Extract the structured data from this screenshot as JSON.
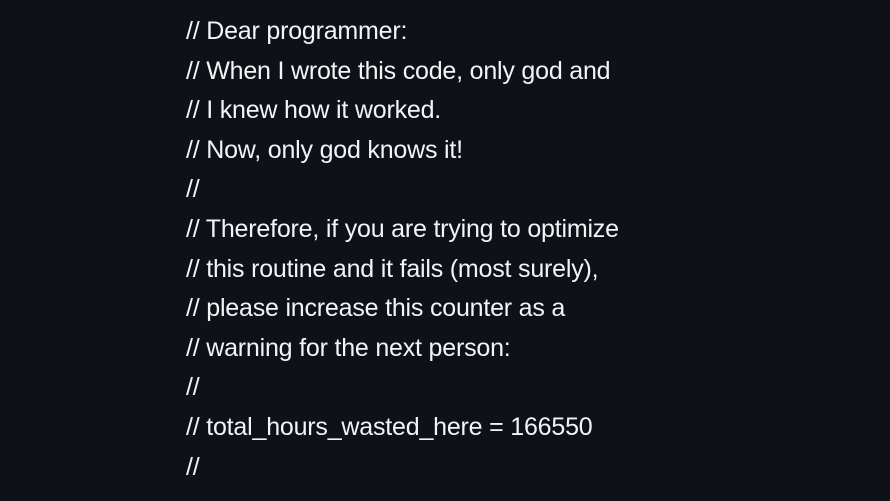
{
  "editor": {
    "lines": [
      "// Dear programmer:",
      "// When I wrote this code, only god and",
      "// I knew how it worked.",
      "// Now, only god knows it!",
      "//",
      "// Therefore, if you are trying to optimize",
      "// this routine and it fails (most surely),",
      "// please increase this counter as a",
      "// warning for the next person:",
      "//",
      "// total_hours_wasted_here = 166550",
      "//"
    ]
  },
  "colors": {
    "background": "#0e1117",
    "text": "#f3f4f6"
  }
}
